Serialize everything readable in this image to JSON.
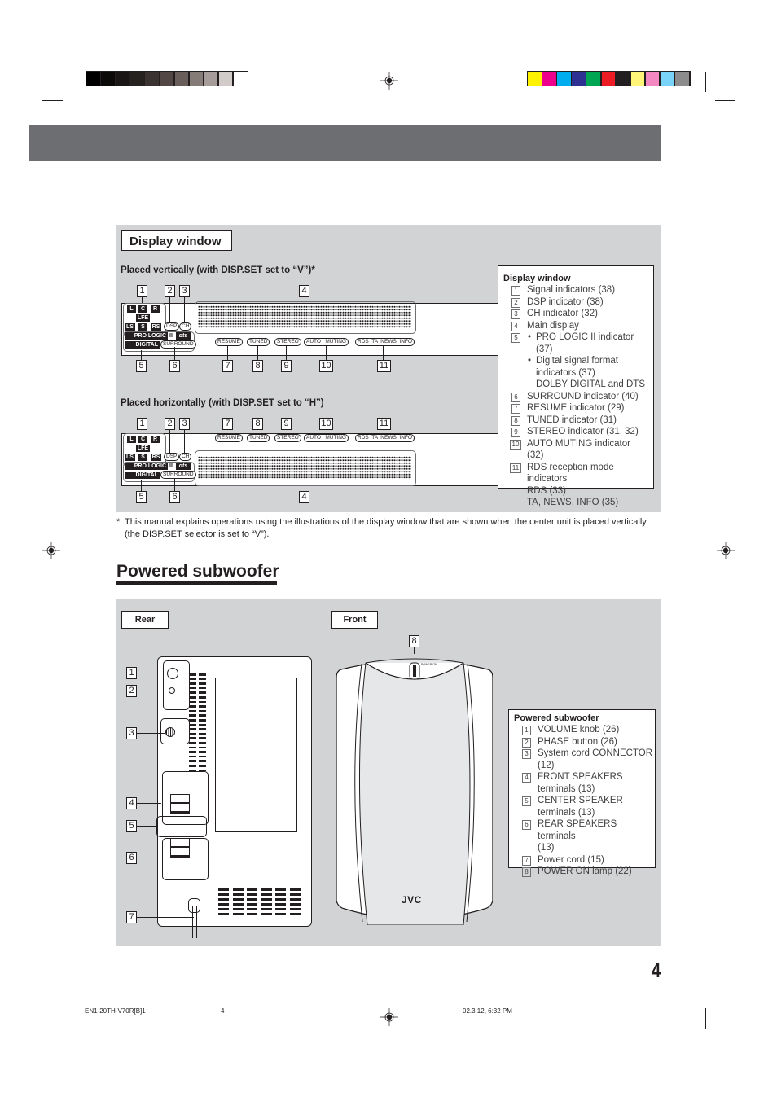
{
  "print_marks": {
    "grayscale_swatches": [
      "#000000",
      "#0b0a09",
      "#191615",
      "#252220",
      "#3b3331",
      "#524744",
      "#6a5e5b",
      "#857b77",
      "#a69c99",
      "#d1cbc9",
      "#ffffff"
    ],
    "color_swatches": [
      "#fff200",
      "#ec008c",
      "#00aeef",
      "#2e3192",
      "#00a651",
      "#ed1c24",
      "#231f20",
      "#fff579",
      "#f388c3",
      "#79d2f7",
      "#8c8c8c"
    ]
  },
  "display_window": {
    "title": "Display window",
    "vertical_caption": "Placed vertically (with DISP.SET set to “V”)*",
    "horizontal_caption": "Placed horizontally (with DISP.SET set to “H”)",
    "signal_labels": {
      "l": "L",
      "c": "C",
      "r": "R",
      "lfe": "LFE",
      "ls": "LS",
      "s": "S",
      "rs": "RS"
    },
    "indicators": {
      "dsp": "DSP",
      "ch": "CH",
      "pro_logic": "PRO LOGIC",
      "pro_logic_ii": "II",
      "dts": "dts",
      "digital": "DIGITAL",
      "surround": "SURROUND",
      "resume": "RESUME",
      "tuned": "TUNED",
      "stereo": "STEREO",
      "auto_muting": "AUTO   MUTING",
      "rds": "RDS  TA  NEWS  INFO"
    },
    "callouts": [
      "1",
      "2",
      "3",
      "4",
      "5",
      "6",
      "7",
      "8",
      "9",
      "10",
      "11"
    ],
    "legend": {
      "title": "Display window",
      "items": [
        {
          "num": "1",
          "lines": [
            "Signal indicators (38)"
          ]
        },
        {
          "num": "2",
          "lines": [
            "DSP indicator (38)"
          ]
        },
        {
          "num": "3",
          "lines": [
            "CH indicator (32)"
          ]
        },
        {
          "num": "4",
          "lines": [
            "Main display"
          ]
        },
        {
          "num": "5",
          "bullets": [
            "PRO LOGIC II indicator (37)",
            "Digital signal format"
          ],
          "lines": [
            "indicators (37)",
            "DOLBY DIGITAL and DTS"
          ]
        },
        {
          "num": "6",
          "lines": [
            "SURROUND indicator (40)"
          ]
        },
        {
          "num": "7",
          "lines": [
            "RESUME indicator (29)"
          ]
        },
        {
          "num": "8",
          "lines": [
            "TUNED indicator (31)"
          ]
        },
        {
          "num": "9",
          "lines": [
            "STEREO indicator (31, 32)"
          ]
        },
        {
          "num": "10",
          "lines": [
            "AUTO MUTING indicator (32)"
          ]
        },
        {
          "num": "11",
          "lines": [
            "RDS reception mode",
            "indicators",
            "RDS (33)",
            "TA, NEWS, INFO (35)"
          ]
        }
      ]
    },
    "footnote_mark": "*",
    "footnote": "This manual explains operations using the illustrations of the display window that are shown when the center unit is placed vertically (the DISP.SET selector is set to “V”)."
  },
  "subwoofer": {
    "section_title": "Powered subwoofer",
    "rear_label": "Rear",
    "front_label": "Front",
    "brand": "JVC",
    "power_lamp_label": "POWER ON",
    "callouts": [
      "1",
      "2",
      "3",
      "4",
      "5",
      "6",
      "7",
      "8"
    ],
    "legend": {
      "title": "Powered subwoofer",
      "items": [
        {
          "num": "1",
          "lines": [
            "VOLUME knob (26)"
          ]
        },
        {
          "num": "2",
          "lines": [
            "PHASE button (26)"
          ]
        },
        {
          "num": "3",
          "lines": [
            "System cord CONNECTOR",
            "(12)"
          ]
        },
        {
          "num": "4",
          "lines": [
            "FRONT SPEAKERS",
            "terminals (13)"
          ]
        },
        {
          "num": "5",
          "lines": [
            "CENTER SPEAKER",
            "terminals (13)"
          ]
        },
        {
          "num": "6",
          "lines": [
            "REAR SPEAKERS terminals",
            "(13)"
          ]
        },
        {
          "num": "7",
          "lines": [
            "Power cord (15)"
          ]
        },
        {
          "num": "8",
          "lines": [
            "POWER ON lamp (22)"
          ]
        }
      ]
    }
  },
  "footer": {
    "page_number": "4",
    "file_name": "EN1-20TH-V70R[B]1",
    "file_page": "4",
    "timestamp": "02.3.12, 6:32 PM"
  }
}
